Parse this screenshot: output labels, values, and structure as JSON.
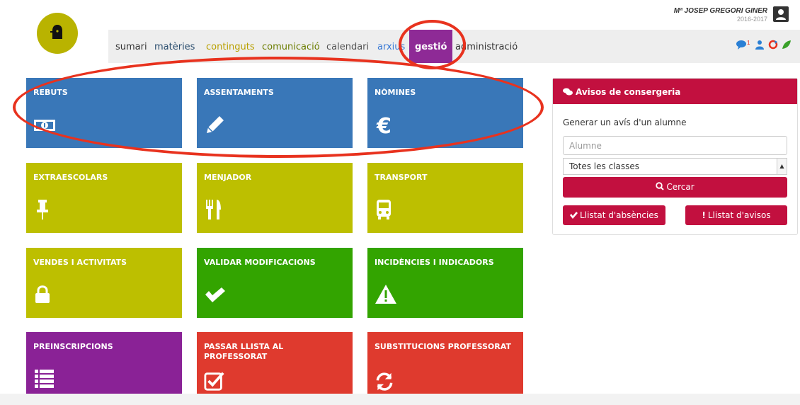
{
  "user": {
    "name": "Mª JOSEP GREGORI GINER",
    "year": "2016-2017"
  },
  "nav": {
    "items": [
      {
        "label": "sumari",
        "color": "#333333"
      },
      {
        "label": "matèries",
        "color": "#2a4d6e"
      },
      {
        "label": "continguts",
        "color": "#b9a000"
      },
      {
        "label": "comunicació",
        "color": "#6b7d00"
      },
      {
        "label": "calendari",
        "color": "#555555"
      },
      {
        "label": "arxius",
        "color": "#3b7bd6"
      },
      {
        "label": "gestió",
        "color": "#ffffff",
        "active": true
      },
      {
        "label": "administració",
        "color": "#333333"
      }
    ],
    "icons": [
      "chat-icon",
      "user-icon",
      "refresh-icon",
      "leaf-icon"
    ],
    "badge": "1"
  },
  "tiles": [
    {
      "title": "REBUTS",
      "color": "blue",
      "icon": "money-icon"
    },
    {
      "title": "ASSENTAMENTS",
      "color": "blue",
      "icon": "pencil-icon"
    },
    {
      "title": "NÒMINES",
      "color": "blue",
      "icon": "euro-icon"
    },
    {
      "title": "EXTRAESCOLARS",
      "color": "olive",
      "icon": "pin-icon"
    },
    {
      "title": "MENJADOR",
      "color": "olive",
      "icon": "cutlery-icon"
    },
    {
      "title": "TRANSPORT",
      "color": "olive",
      "icon": "bus-icon"
    },
    {
      "title": "VENDES I ACTIVITATS",
      "color": "olive",
      "icon": "lock-icon"
    },
    {
      "title": "VALIDAR MODIFICACIONS",
      "color": "green",
      "icon": "check-icon"
    },
    {
      "title": "INCIDÈNCIES I INDICADORS",
      "color": "green",
      "icon": "warning-icon"
    },
    {
      "title": "PREINSCRIPCIONS",
      "color": "purple",
      "icon": "list-icon"
    },
    {
      "title": "PASSAR LLISTA AL PROFESSORAT",
      "color": "red",
      "icon": "checkbox-icon"
    },
    {
      "title": "SUBSTITUCIONS PROFESSORAT",
      "color": "red",
      "icon": "refresh-icon"
    }
  ],
  "panel": {
    "title": "Avisos de consergeria",
    "subtitle": "Generar un avís d'un alumne",
    "input_placeholder": "Alumne",
    "select_value": "Totes les classes",
    "search_label": "Cercar",
    "absences_label": "Llistat d'absències",
    "notices_label": "Llistat d'avisos"
  },
  "colors": {
    "blue": "#3977b8",
    "olive": "#bdbf00",
    "green": "#33a400",
    "purple": "#8a2296",
    "red": "#df3a2e",
    "panel": "#c2103f",
    "annotation": "#e8321e"
  }
}
